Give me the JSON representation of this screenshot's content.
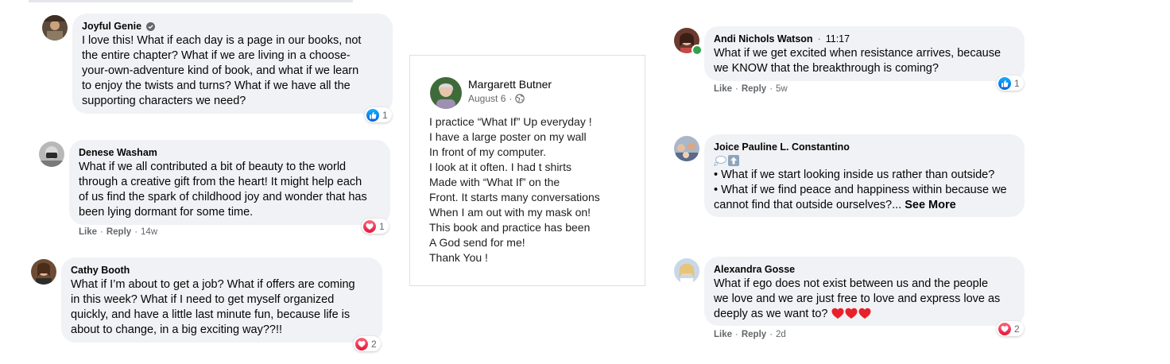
{
  "left_comments": [
    {
      "name": "Joyful Genie",
      "verified": true,
      "lines": [
        "I love this! What if each day is a page in our books, not",
        "the entire chapter? What if we are living in a choose-",
        "your-own-adventure kind of book, and what if we learn",
        "to enjoy the twists and turns? What if we have all the",
        "supporting characters we need?"
      ],
      "reaction": {
        "type": "like",
        "count": "1"
      }
    },
    {
      "name": "Denese Washam",
      "lines": [
        "What if we all contributed a bit of beauty to the world",
        "through a creative gift from the heart! It might help each",
        "of us find the spark of childhood joy and wonder that has",
        "been lying dormant for some time."
      ],
      "reaction": {
        "type": "love",
        "count": "1"
      },
      "actions": {
        "like": "Like",
        "reply": "Reply",
        "time": "14w"
      }
    },
    {
      "name": "Cathy Booth",
      "lines": [
        "What if I’m about to get a job? What if offers are coming",
        "in this week? What if I need to get myself organized",
        "quickly, and have a little last minute fun, because life is",
        "about to change, in a big exciting way??!!"
      ],
      "reaction": {
        "type": "love",
        "count": "2"
      }
    }
  ],
  "post": {
    "author": "Margarett Butner",
    "date": "August 6",
    "privacy_icon": "globe-icon",
    "lines": [
      "I practice “What If” Up everyday !",
      "I have a large poster on my wall",
      "In front of my computer.",
      "I look at it often. I had t shirts",
      "Made with “What If” on the",
      "Front. It starts many conversations",
      "When I am out with my mask on!",
      "This book and practice has been",
      "A God send for me!",
      "Thank You !"
    ]
  },
  "right_comments": [
    {
      "name": "Andi Nichols Watson",
      "time": "11:17",
      "online": true,
      "lines": [
        "What if we get excited when resistance arrives, because",
        "we KNOW that the breakthrough is coming?"
      ],
      "reaction": {
        "type": "like",
        "count": "1"
      },
      "actions": {
        "like": "Like",
        "reply": "Reply",
        "time": "5w"
      }
    },
    {
      "name": "Joice Pauline L. Constantino",
      "icons": [
        "thought-bubble-icon",
        "up-arrow-icon"
      ],
      "lines": [
        "• What if we start looking inside us rather than outside?",
        "• What if we find peace and happiness within because we"
      ],
      "last_line_prefix": "cannot find that outside ourselves?...",
      "see_more": "See More"
    },
    {
      "name": "Alexandra Gosse",
      "lines": [
        "What if ego does not exist between us and the people",
        "we love and we are just free to love and express love as"
      ],
      "last_line_prefix": "deeply as we want to?",
      "emoji": "red-heart-icon",
      "reaction": {
        "type": "love",
        "count": "2"
      },
      "actions": {
        "like": "Like",
        "reply": "Reply",
        "time": "2d"
      }
    }
  ],
  "colors": {
    "bubble": "#f0f2f5",
    "like_blue": "#1877f2",
    "love_red": "#f33e58",
    "muted": "#65676b",
    "online_green": "#31a24c"
  }
}
